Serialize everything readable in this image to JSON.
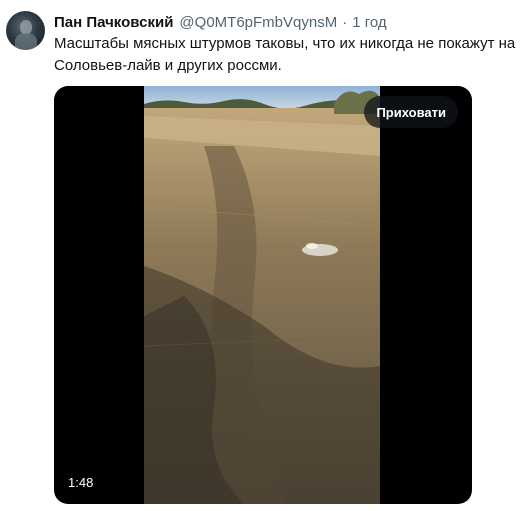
{
  "tweet": {
    "author": {
      "display_name": "Пан Пачковский",
      "handle": "@Q0MT6pFmbVqynsM",
      "avatar_icon": "avatar-photo"
    },
    "separator": "·",
    "time": "1 год",
    "text": "Масштабы мясных штурмов таковы, что их никогда не покажут на Соловьев-лайв и других россми."
  },
  "media": {
    "type": "video",
    "hide_button_label": "Приховати",
    "duration": "1:48",
    "background_color": "#000000"
  },
  "colors": {
    "text_primary": "#0f1419",
    "text_secondary": "#536471"
  }
}
